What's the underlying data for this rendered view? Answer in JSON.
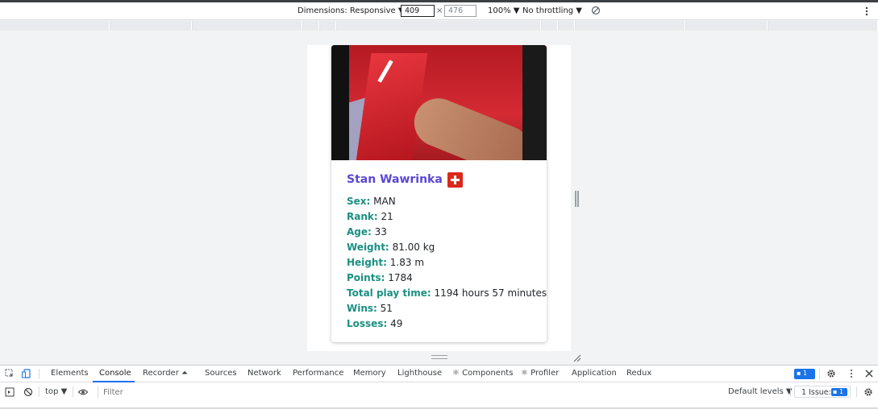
{
  "device_toolbar": {
    "dimensions_label": "Dimensions: Responsive ▼",
    "width_value": "409",
    "height_value": "476",
    "times": "×",
    "zoom": "100% ▼",
    "throttling": "No throttling ▼"
  },
  "player": {
    "name": "Stan Wawrinka",
    "flag_country": "Switzerland",
    "stats": [
      {
        "key": "Sex:",
        "value": "MAN"
      },
      {
        "key": "Rank:",
        "value": "21"
      },
      {
        "key": "Age:",
        "value": "33"
      },
      {
        "key": "Weight:",
        "value": "81.00 kg"
      },
      {
        "key": "Height:",
        "value": "1.83 m"
      },
      {
        "key": "Points:",
        "value": "1784"
      },
      {
        "key": "Total play time:",
        "value": "1194 hours 57 minutes"
      },
      {
        "key": "Wins:",
        "value": "51"
      },
      {
        "key": "Losses:",
        "value": "49"
      }
    ],
    "colors": {
      "name": "#5b46d6",
      "label": "#1a8f82",
      "flag": "#da291c"
    }
  },
  "devtools": {
    "tabs": [
      "Elements",
      "Console",
      "Recorder ⏶",
      "Sources",
      "Network",
      "Performance",
      "Memory",
      "Lighthouse",
      "⚛ Components",
      "⚛ Profiler",
      "Application",
      "Redux"
    ],
    "active_tab": "Console",
    "messages_badge": "1",
    "context": "top ▼",
    "filter_placeholder": "Filter",
    "levels": "Default levels ▼",
    "issues_label": "1 Issue:",
    "issues_count": "1"
  }
}
